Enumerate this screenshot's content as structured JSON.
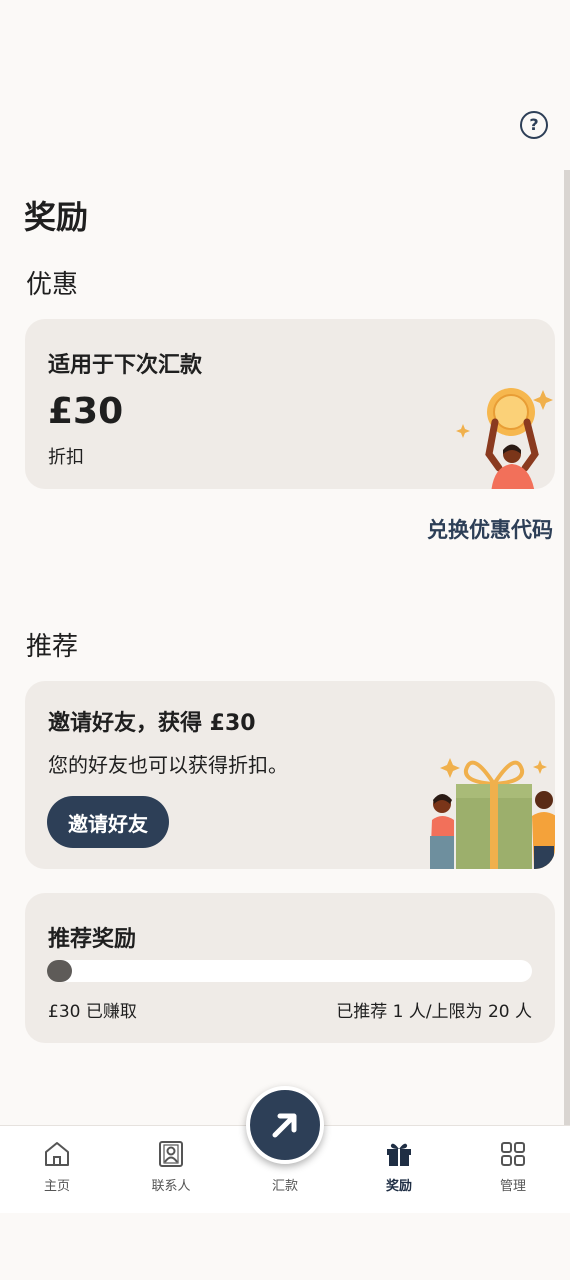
{
  "page_title": "奖励",
  "offers": {
    "heading": "优惠",
    "card": {
      "subtitle": "适用于下次汇款",
      "amount": "£30",
      "unit": "折扣"
    },
    "redeem_label": "兑换优惠代码"
  },
  "referral": {
    "heading": "推荐",
    "invite": {
      "title": "邀请好友，获得 £30",
      "desc": "您的好友也可以获得折扣。",
      "button_label": "邀请好友"
    },
    "rewards": {
      "title": "推荐奖励",
      "earned": "£30 已赚取",
      "count": "已推荐 1 人/上限为 20 人",
      "progress_fraction": 0.05
    }
  },
  "nav": {
    "items": [
      {
        "label": "主页",
        "icon": "home-icon"
      },
      {
        "label": "联系人",
        "icon": "contacts-icon"
      },
      {
        "label": "汇款",
        "icon": "send-arrow-icon"
      },
      {
        "label": "奖励",
        "icon": "gift-icon",
        "active": true
      },
      {
        "label": "管理",
        "icon": "grid-icon"
      }
    ]
  },
  "colors": {
    "accent": "#2d3f57",
    "card_bg": "#efebe7",
    "page_bg": "#fbf9f7"
  }
}
